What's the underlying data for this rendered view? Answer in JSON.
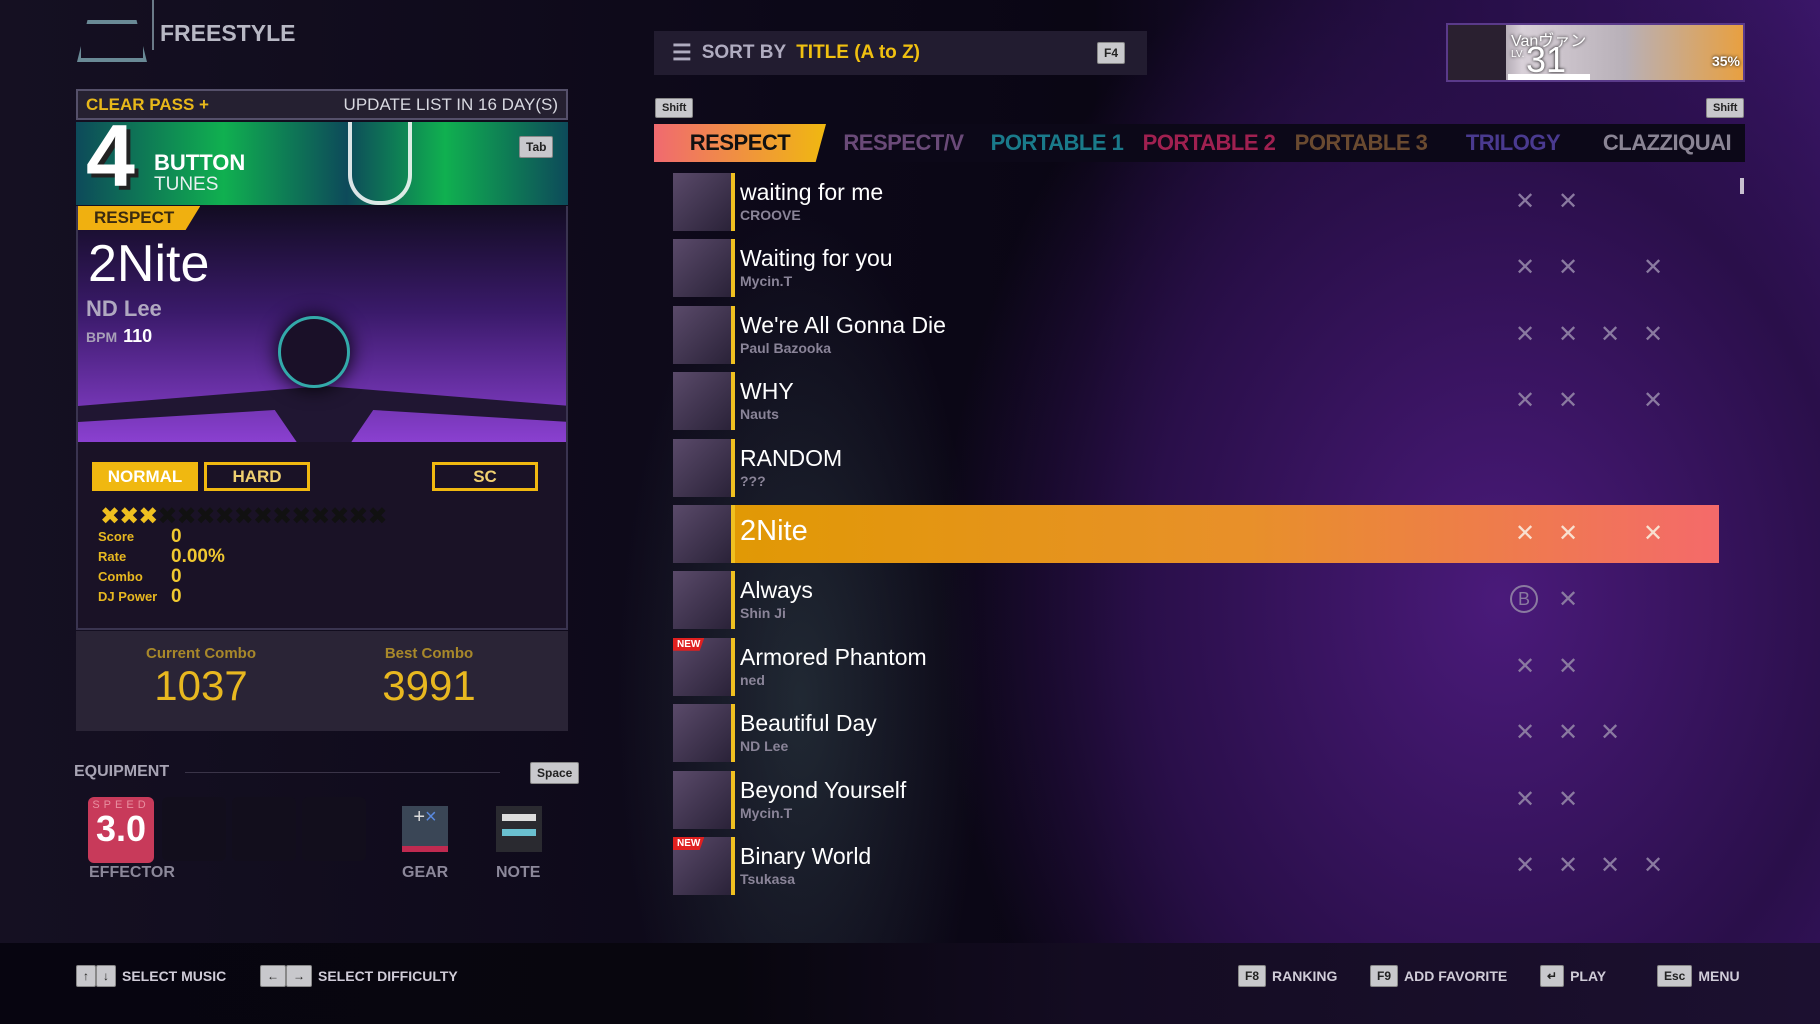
{
  "header": {
    "mode": "FREESTYLE",
    "logo_icon": "djmax-logo"
  },
  "clear_pass": {
    "label": "CLEAR PASS +",
    "update": "UPDATE LIST IN 16 DAY(S)"
  },
  "banner": {
    "number": "4",
    "button": "BUTTON",
    "tunes": "TUNES",
    "key": "Tab"
  },
  "song": {
    "pack": "RESPECT",
    "title": "2Nite",
    "artist": "ND Lee",
    "bpm_label": "BPM",
    "bpm": "110"
  },
  "difficulty": {
    "normal": "NORMAL",
    "hard": "HARD",
    "sc": "SC",
    "selected": "NORMAL",
    "level": 3,
    "max_level": 15
  },
  "stats": [
    {
      "label": "Score",
      "value": "0"
    },
    {
      "label": "Rate",
      "value": "0.00%"
    },
    {
      "label": "Combo",
      "value": "0"
    },
    {
      "label": "DJ Power",
      "value": "0"
    }
  ],
  "combo": {
    "current_label": "Current Combo",
    "current": "1037",
    "best_label": "Best Combo",
    "best": "3991"
  },
  "equipment": {
    "title": "EQUIPMENT",
    "key": "Space",
    "speed_label": "SPEED",
    "speed": "3.0",
    "effector": "EFFECTOR",
    "gear": "GEAR",
    "note": "NOTE"
  },
  "sort": {
    "label": "SORT BY",
    "value": "TITLE (A to Z)",
    "key": "F4"
  },
  "profile": {
    "name": "Vanヴァン",
    "lv_label": "LV.",
    "level": "31",
    "progress": "35%"
  },
  "shift_key": "Shift",
  "tabs": [
    {
      "label": "RESPECT",
      "color": "#111111"
    },
    {
      "label": "RESPECT/V",
      "color": "#6a4a78"
    },
    {
      "label": "PORTABLE 1",
      "color": "#1a7a8a"
    },
    {
      "label": "PORTABLE 2",
      "color": "#a02050"
    },
    {
      "label": "PORTABLE 3",
      "color": "#6a4a30"
    },
    {
      "label": "TRILOGY",
      "color": "#4a3a90"
    },
    {
      "label": "CLAZZIQUAI",
      "color": "#8a8494"
    }
  ],
  "songs": [
    {
      "title": "waiting for me",
      "artist": "CROOVE",
      "marks": [
        "x",
        "x",
        "",
        ""
      ]
    },
    {
      "title": "Waiting for you",
      "artist": "Mycin.T",
      "marks": [
        "x",
        "x",
        "",
        "x"
      ]
    },
    {
      "title": "We're All Gonna Die",
      "artist": "Paul Bazooka",
      "marks": [
        "x",
        "x",
        "x",
        "x"
      ]
    },
    {
      "title": "WHY",
      "artist": "Nauts",
      "marks": [
        "x",
        "x",
        "",
        "x"
      ]
    },
    {
      "title": "RANDOM",
      "artist": "???",
      "marks": [
        "",
        "",
        "",
        ""
      ]
    },
    {
      "title": "2Nite",
      "artist": "",
      "marks": [
        "x",
        "x",
        "",
        "x"
      ],
      "selected": true
    },
    {
      "title": "Always",
      "artist": "Shin Ji",
      "marks": [
        "B",
        "x",
        "",
        ""
      ]
    },
    {
      "title": "Armored Phantom",
      "artist": "ned",
      "marks": [
        "x",
        "x",
        "",
        ""
      ],
      "new": "NEW"
    },
    {
      "title": "Beautiful Day",
      "artist": "ND Lee",
      "marks": [
        "x",
        "x",
        "x",
        ""
      ]
    },
    {
      "title": "Beyond Yourself",
      "artist": "Mycin.T",
      "marks": [
        "x",
        "x",
        "",
        ""
      ]
    },
    {
      "title": "Binary World",
      "artist": "Tsukasa",
      "marks": [
        "x",
        "x",
        "x",
        "x"
      ],
      "new": "NEW"
    }
  ],
  "footer": [
    {
      "keys": [
        "↑",
        "↓"
      ],
      "label": "SELECT MUSIC"
    },
    {
      "keys": [
        "←",
        "→"
      ],
      "label": "SELECT DIFFICULTY"
    },
    {
      "keys": [
        "F8"
      ],
      "label": "RANKING"
    },
    {
      "keys": [
        "F9"
      ],
      "label": "ADD FAVORITE"
    },
    {
      "keys": [
        "↵"
      ],
      "label": "PLAY"
    },
    {
      "keys": [
        "Esc"
      ],
      "label": "MENU"
    }
  ],
  "colors": {
    "accent": "#f0b810",
    "selected_row_start": "#e09a00",
    "selected_row_end": "#f46a6a"
  }
}
